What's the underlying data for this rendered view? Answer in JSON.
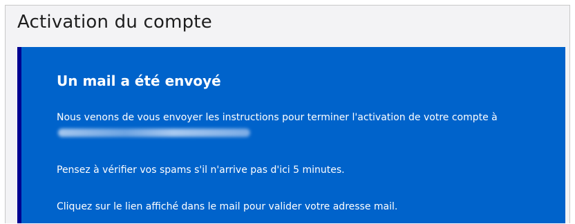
{
  "page": {
    "title": "Activation du compte"
  },
  "notice": {
    "title": "Un mail a été envoyé",
    "line1": "Nous venons de vous envoyer les instructions pour terminer l'activation de votre compte à",
    "email_redacted": true,
    "line2": "Pensez à vérifier vos spams s'il n'arrive pas d'ici 5 minutes.",
    "line3": "Cliquez sur le lien affiché dans le mail pour valider votre adresse mail.",
    "background_color": "#0063cb",
    "accent_border_color": "#000091"
  }
}
